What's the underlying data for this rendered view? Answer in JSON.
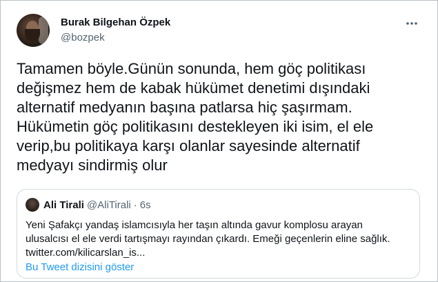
{
  "author": {
    "name": "Burak Bilgehan Özpek",
    "handle": "@bozpek"
  },
  "tweet": {
    "text": "Tamamen böyle.Günün sonunda, hem göç politikası\ndeğişmez hem de kabak hükümet denetimi dışındaki\nalternatif medyanın başına patlarsa hiç şaşırmam.\nHükümetin göç politikasını destekleyen iki isim, el ele\nverip,bu politikaya karşı olanlar sayesinde alternatif\nmedyayı sindirmiş olur"
  },
  "quoted": {
    "name": "Ali Tirali",
    "handle": "@AliTirali",
    "separator": "·",
    "time": "6s",
    "text": "Yeni Şafakçı yandaş islamcısıyla her taşın altında gavur komplosu arayan\nulusalcısı el ele verdi tartışmayı rayından çıkardı. Emeği geçenlerin eline sağlık.\ntwitter.com/kilicarslan_is...",
    "show_thread": "Bu Tweet dizisini göster"
  },
  "icons": {
    "more": "more-horizontal-icon",
    "avatar": "profile-photo"
  },
  "colors": {
    "link": "#1d9bf0",
    "secondary_text": "#536471",
    "primary_text": "#0f1419",
    "border": "#cfd9de"
  }
}
